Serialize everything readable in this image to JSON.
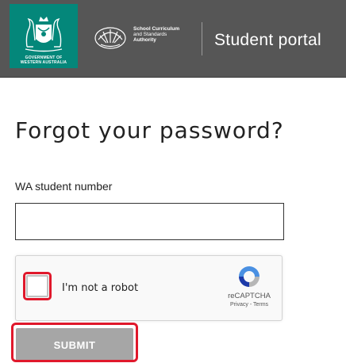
{
  "header": {
    "gov_logo_text_line1": "GOVERNMENT OF",
    "gov_logo_text_line2": "WESTERN AUSTRALIA",
    "scsa_logo_line1": "School Curriculum",
    "scsa_logo_line2": "and Standards",
    "scsa_logo_line3": "Authority",
    "portal_title": "Student portal"
  },
  "main": {
    "heading": "Forgot your password?",
    "student_number_label": "WA student number",
    "student_number_value": "",
    "submit_label": "SUBMIT"
  },
  "recaptcha": {
    "label": "I'm not a robot",
    "brand": "reCAPTCHA",
    "links": "Privacy - Terms",
    "checked": false
  },
  "colors": {
    "header_bg": "#565656",
    "gov_logo_bg": "#04877a",
    "highlight": "#e0182b",
    "submit_bg": "#a6a6a6"
  },
  "icons": {
    "gov_crest": "wa-coat-of-arms-icon",
    "scsa": "scsa-fan-logo-icon",
    "recaptcha": "recaptcha-arrows-icon"
  }
}
